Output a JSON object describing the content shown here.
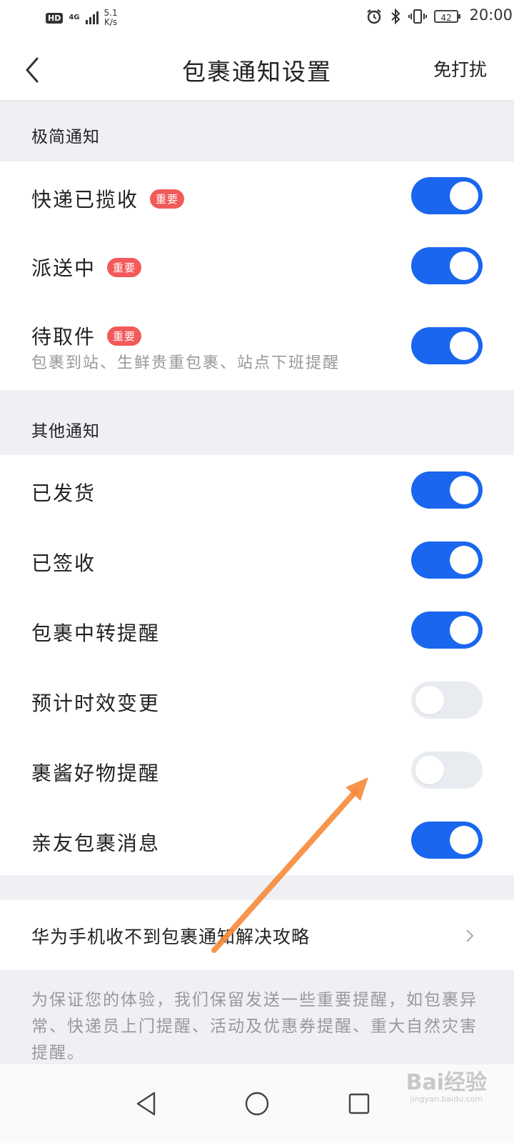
{
  "status_bar": {
    "hd": "HD",
    "network": "4G",
    "speed_value": "5.1",
    "speed_unit": "K/s",
    "battery": "42",
    "time": "20:00"
  },
  "header": {
    "title": "包裹通知设置",
    "action": "免打扰"
  },
  "sections": [
    {
      "label": "极简通知",
      "items": [
        {
          "label": "快递已揽收",
          "badge": "重要",
          "on": true
        },
        {
          "label": "派送中",
          "badge": "重要",
          "on": true
        },
        {
          "label": "待取件",
          "badge": "重要",
          "sub": "包裹到站、生鲜贵重包裹、站点下班提醒",
          "on": true
        }
      ]
    },
    {
      "label": "其他通知",
      "items": [
        {
          "label": "已发货",
          "on": true
        },
        {
          "label": "已签收",
          "on": true
        },
        {
          "label": "包裹中转提醒",
          "on": true
        },
        {
          "label": "预计时效变更",
          "on": false
        },
        {
          "label": "裹酱好物提醒",
          "on": false
        },
        {
          "label": "亲友包裹消息",
          "on": true
        }
      ]
    }
  ],
  "help_link": "华为手机收不到包裹通知解决攻略",
  "footer_note": "为保证您的体验，我们保留发送一些重要提醒，如包裹异常、快递员上门提醒、活动及优惠券提醒、重大自然灾害提醒。",
  "colors": {
    "toggle_on": "#1a66ee",
    "toggle_off": "#e8ebf0",
    "badge": "#f25a5a",
    "annotation_arrow": "#f78a3a"
  },
  "watermark": {
    "main": "Bai经验",
    "sub": "jingyan.baidu.com"
  }
}
